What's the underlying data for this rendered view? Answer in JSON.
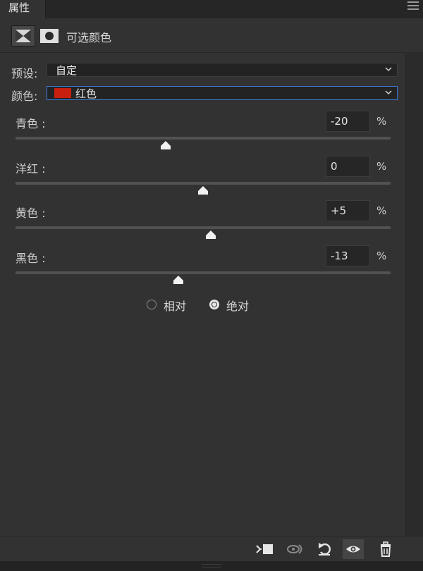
{
  "tab": {
    "label": "属性"
  },
  "header": {
    "title": "可选颜色"
  },
  "preset": {
    "label": "预设:",
    "value": "自定"
  },
  "color": {
    "label": "颜色:",
    "value": "红色",
    "swatch": "#c8200e"
  },
  "sliders": [
    {
      "label": "青色 :",
      "value": "-20",
      "unit": "%",
      "position_fraction": 0.4
    },
    {
      "label": "洋红 :",
      "value": "0",
      "unit": "%",
      "position_fraction": 0.5
    },
    {
      "label": "黄色 :",
      "value": "+5",
      "unit": "%",
      "position_fraction": 0.52
    },
    {
      "label": "黑色 :",
      "value": "-13",
      "unit": "%",
      "position_fraction": 0.435
    }
  ],
  "method": {
    "options": [
      {
        "label": "相对",
        "selected": false
      },
      {
        "label": "绝对",
        "selected": true
      }
    ]
  },
  "toolbar": {
    "icons": [
      "clip-to-layer-icon",
      "view-previous-state-icon",
      "reset-icon",
      "visibility-eye-icon",
      "trash-icon"
    ]
  }
}
